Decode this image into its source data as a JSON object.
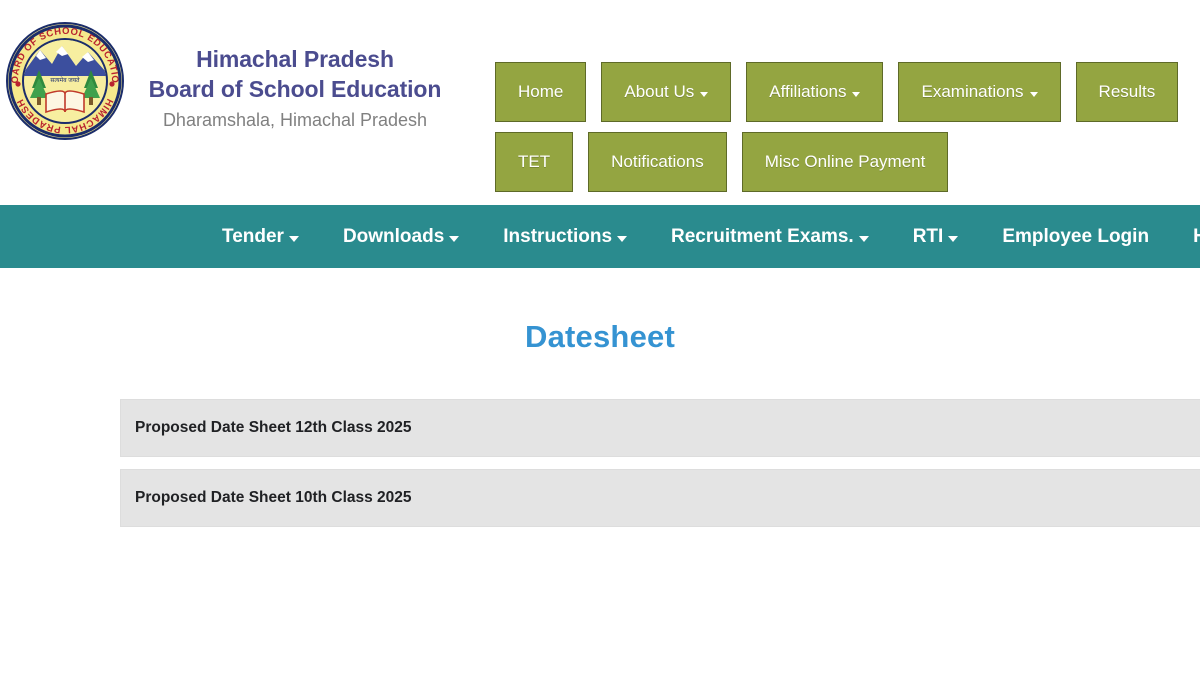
{
  "site": {
    "brand": {
      "line1": "Himachal Pradesh",
      "line2": "Board of School Education",
      "subtitle": "Dharamshala, Himachal Pradesh",
      "logo_alt": "board-of-school-education-himachal-pradesh-emblem",
      "logo_top_text": "BOARD OF SCHOOL EDUCATION",
      "logo_bottom_text": "HIMACHAL PRADESH"
    },
    "colors": {
      "olive": "#94a541",
      "olive_border": "#5e6a28",
      "teal": "#2a8b8e",
      "title_blue": "#3593d2",
      "brand_navy": "#4b4c8f",
      "brand_gray": "#808080",
      "list_gray": "#e4e4e4"
    }
  },
  "topmenu": {
    "row1": [
      {
        "label": "Home",
        "caret": false
      },
      {
        "label": "About Us",
        "caret": true
      },
      {
        "label": "Affiliations",
        "caret": true
      },
      {
        "label": "Examinations",
        "caret": true
      },
      {
        "label": "Results",
        "caret": false
      }
    ],
    "row2": [
      {
        "label": "TET",
        "caret": false
      },
      {
        "label": "Notifications",
        "caret": false
      },
      {
        "label": "Misc Online Payment",
        "caret": false
      }
    ]
  },
  "tealnav": {
    "items": [
      {
        "label": "Tender",
        "caret": true
      },
      {
        "label": "Downloads",
        "caret": true
      },
      {
        "label": "Instructions",
        "caret": true
      },
      {
        "label": "Recruitment Exams.",
        "caret": true
      },
      {
        "label": "RTI",
        "caret": true
      },
      {
        "label": "Employee Login",
        "caret": false
      },
      {
        "label": "He",
        "caret": false
      }
    ]
  },
  "main": {
    "title": "Datesheet",
    "items": [
      {
        "label": "Proposed Date Sheet 12th Class 2025"
      },
      {
        "label": "Proposed Date Sheet 10th Class 2025"
      }
    ]
  }
}
